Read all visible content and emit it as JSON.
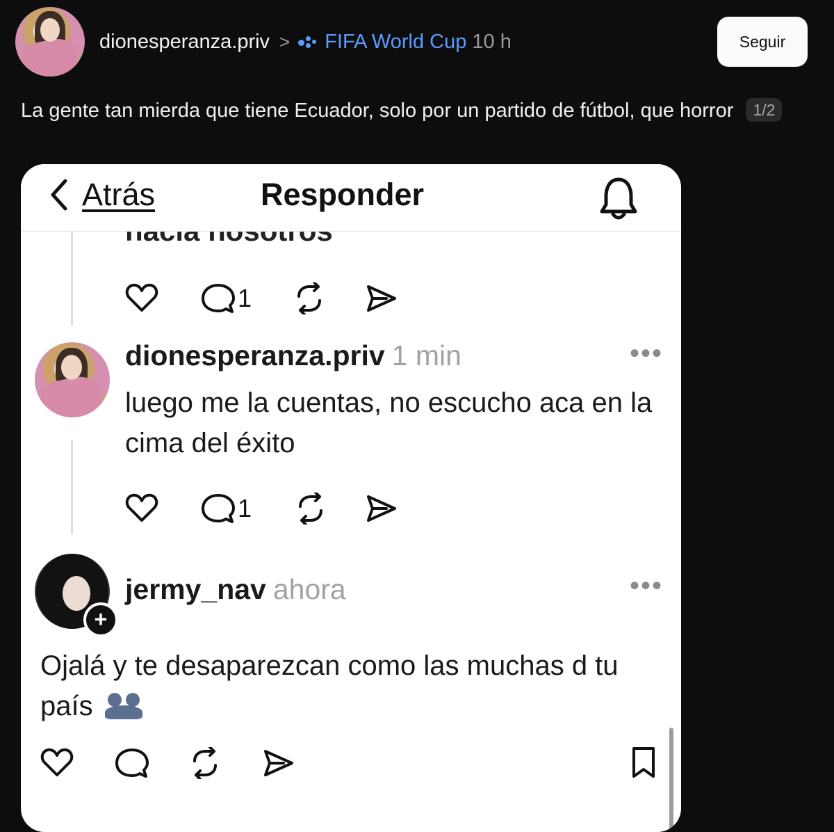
{
  "post": {
    "username": "dionesperanza.priv",
    "separator": ">",
    "community": "FIFA World Cup",
    "time": "10 h",
    "follow_label": "Seguir",
    "caption": "La gente tan mierda que tiene Ecuador, solo por un partido de fútbol, que horror",
    "counter": "1/2"
  },
  "screenshot": {
    "back_label": "Atrás",
    "title": "Responder",
    "cut_text": "hacia nosotros",
    "first_actions": {
      "reply_count": "1"
    },
    "reply1": {
      "username": "dionesperanza.priv",
      "time": "1 min",
      "more": "•••",
      "text": "luego me la cuentas, no escucho aca en la cima del éxito",
      "reply_count": "1"
    },
    "reply2": {
      "username": "jermy_nav",
      "time": "ahora",
      "more": "•••",
      "badge": "+",
      "text": "Ojalá y te desaparezcan como las muchas d tu país"
    }
  },
  "icons": [
    "heart-icon",
    "comment-icon",
    "repost-icon",
    "share-icon",
    "bookmark-icon",
    "bell-icon",
    "back-chevron-icon",
    "community-icon"
  ]
}
